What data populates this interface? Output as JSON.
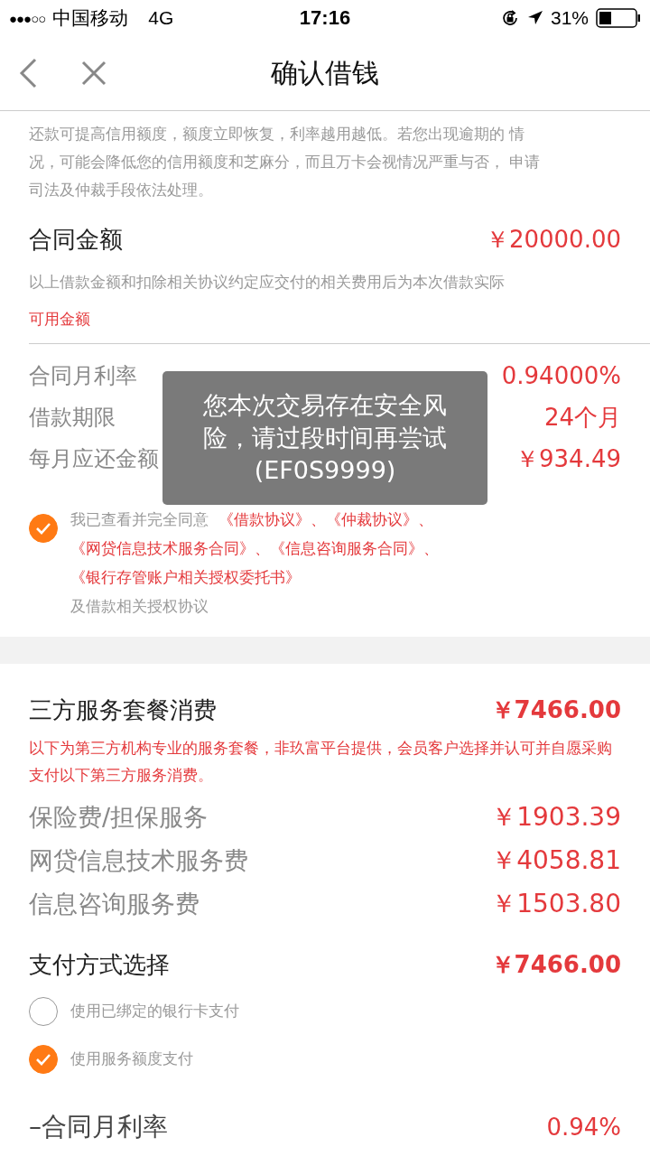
{
  "status_bar": {
    "signal": "●●●○○",
    "carrier": "中国移动",
    "network": "4G",
    "time": "17:16",
    "battery": "31%"
  },
  "nav": {
    "title": "确认借钱"
  },
  "intro_lines": [
    "还款可提高信用额度，额度立即恢复，利率越用越低。若您出现逾期的 情",
    "况，可能会降低您的信用额度和芝麻分，而且万卡会视情况严重与否， 申请",
    "司法及仲裁手段依法处理。"
  ],
  "contract": {
    "label": "合同金额",
    "value": "￥20000.00",
    "note": "以上借款金额和扣除相关协议约定应交付的相关费用后为本次借款实际",
    "note_red": "可用金额"
  },
  "loan_rows": [
    {
      "label": "合同月利率",
      "value": "0.94000%"
    },
    {
      "label": "借款期限",
      "value": "24个月"
    },
    {
      "label": "每月应还金额",
      "value": "￥934.49"
    }
  ],
  "agreement": {
    "checked": true,
    "text": "我已查看并完全同意",
    "links": [
      "《借款协议》",
      "《仲裁协议》",
      "《网贷信息技术服务合同》",
      "《信息咨询服务合同》",
      "《银行存管账户相关授权委托书》"
    ],
    "separator": "、",
    "tail": "及借款相关授权协议"
  },
  "services": {
    "title": "三方服务套餐消费",
    "total": "￥7466.00",
    "note": "以下为第三方机构专业的服务套餐，非玖富平台提供，会员客户选择并认可并自愿采购支付以下第三方服务消费。",
    "items": [
      {
        "label": "保险费/担保服务",
        "value": "￥1903.39"
      },
      {
        "label": "网贷信息技术服务费",
        "value": "￥4058.81"
      },
      {
        "label": "信息咨询服务费",
        "value": "￥1503.80"
      }
    ]
  },
  "payment": {
    "title": "支付方式选择",
    "total": "￥7466.00",
    "options": [
      {
        "label": "使用已绑定的银行卡支付",
        "selected": false
      },
      {
        "label": "使用服务额度支付",
        "selected": true
      }
    ]
  },
  "summary_rows": [
    {
      "label": "–合同月利率",
      "value": "0.94%"
    }
  ],
  "toast": {
    "text": "您本次交易存在安全风险，请过段时间再尝试(EF0S9999)"
  }
}
